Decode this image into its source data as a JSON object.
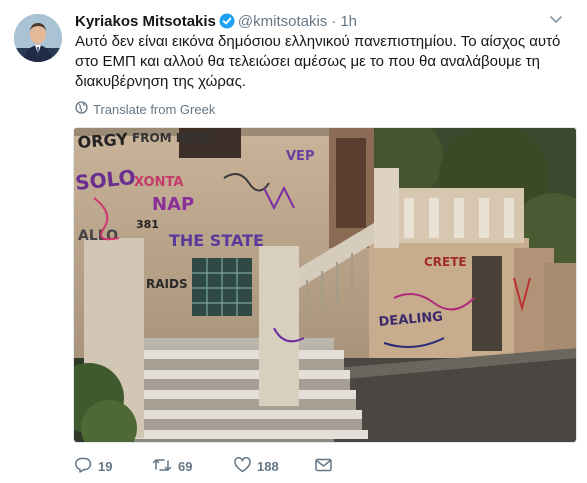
{
  "author": {
    "name": "Kyriakos Mitsotakis",
    "handle": "@kmitsotakis",
    "dot": "·",
    "time": "1h",
    "avatar_icon": "avatar-photo"
  },
  "tweet": {
    "text": "Αυτό δεν είναι εικόνα δημόσιου ελληνικού πανεπιστημίου. Το αίσχος αυτό στο ΕΜΠ και αλλού θα τελειώσει αμέσως με το που θα αναλάβουμε τη διακυβέρνηση της χώρας."
  },
  "translate": {
    "label": "Translate from Greek",
    "icon": "globe-icon"
  },
  "photo": {
    "graffiti": [
      "ORGY",
      "FROM HERE",
      "VEP",
      "XONTA",
      "NAP",
      "SOLO",
      "381",
      "ALLO",
      "THE STATE",
      "RAIDS",
      "CRETE",
      "DEALING"
    ]
  },
  "actions": {
    "replies": "19",
    "retweets": "69",
    "likes": "188"
  },
  "colors": {
    "accent": "#1da1f2",
    "muted": "#657786",
    "text": "#14171a"
  }
}
